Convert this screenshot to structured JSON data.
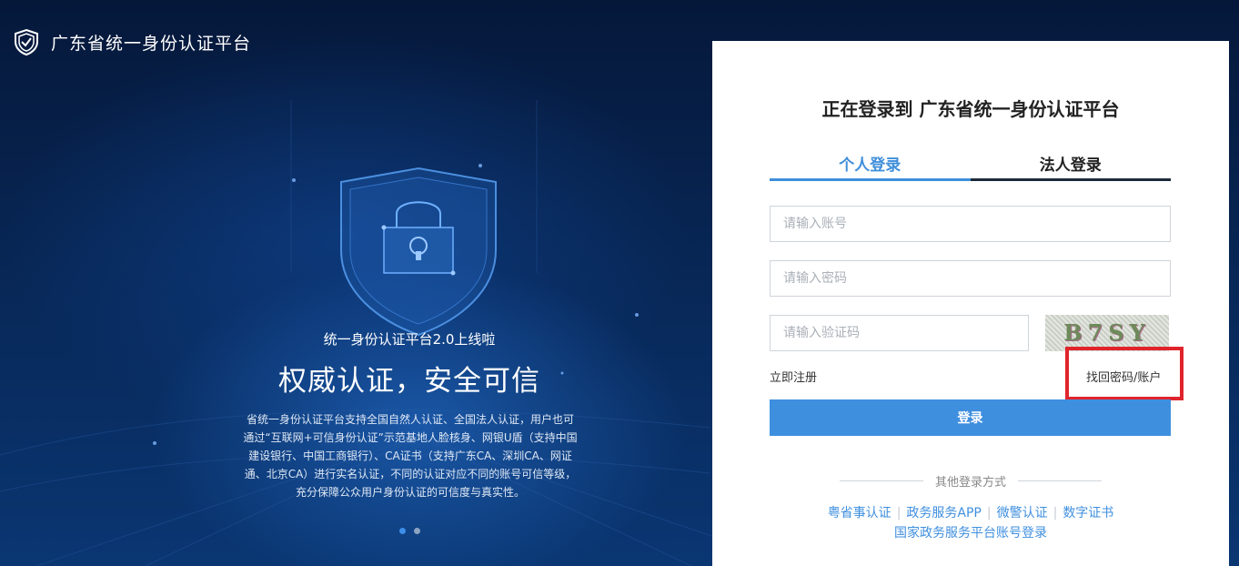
{
  "header": {
    "title": "广东省统一身份认证平台"
  },
  "hero": {
    "subtitle": "统一身份认证平台2.0上线啦",
    "title": "权威认证，安全可信",
    "description": "省统一身份认证平台支持全国自然人认证、全国法人认证，用户也可通过“互联网+可信身份认证”示范基地人脸核身、网银U盾（支持中国建设银行、中国工商银行）、CA证书（支持广东CA、深圳CA、网证通、北京CA）进行实名认证，不同的认证对应不同的账号可信等级，充分保障公众用户身份认证的可信度与真实性。",
    "carousel_active_index": 0
  },
  "login": {
    "title": "正在登录到 广东省统一身份认证平台",
    "tabs": [
      {
        "label": "个人登录",
        "active": true
      },
      {
        "label": "法人登录",
        "active": false
      }
    ],
    "account_placeholder": "请输入账号",
    "password_placeholder": "请输入密码",
    "captcha_placeholder": "请输入验证码",
    "captcha_text": "B7SY",
    "register_label": "立即注册",
    "recover_label": "找回密码/账户",
    "submit_label": "登录",
    "other_methods_label": "其他登录方式",
    "other_methods": [
      "粤省事认证",
      "政务服务APP",
      "微警认证",
      "数字证书"
    ],
    "separator": "|",
    "national_link": "国家政务服务平台账号登录"
  },
  "colors": {
    "accent": "#3f8fdf",
    "highlight_box": "#e0242b",
    "background_dark": "#061a3d"
  }
}
